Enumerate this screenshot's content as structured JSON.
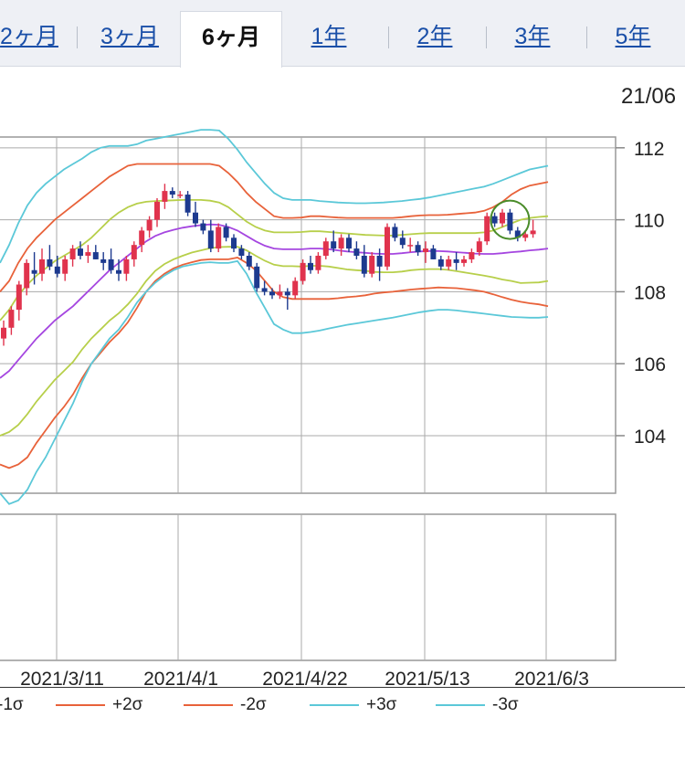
{
  "tabs": [
    {
      "label": "2ヶ月",
      "active": false
    },
    {
      "label": "3ヶ月",
      "active": false
    },
    {
      "label": "6ヶ月",
      "active": true
    },
    {
      "label": "1年",
      "active": false
    },
    {
      "label": "2年",
      "active": false
    },
    {
      "label": "3年",
      "active": false
    },
    {
      "label": "5年",
      "active": false
    }
  ],
  "date_label": "21/06",
  "legend": [
    {
      "label": "-1σ",
      "color": "#b7cf4a"
    },
    {
      "label": "+2σ",
      "color": "#e8623a"
    },
    {
      "label": "-2σ",
      "color": "#e8623a"
    },
    {
      "label": "+3σ",
      "color": "#5bc8d8"
    },
    {
      "label": "-3σ",
      "color": "#5bc8d8"
    }
  ],
  "chart_data": {
    "type": "line",
    "ylim": [
      102.4,
      112.3
    ],
    "y_ticks": [
      "112",
      "110",
      "108",
      "106",
      "104"
    ],
    "x_tick_labels": [
      "2021/3/11",
      "2021/4/1",
      "2021/4/22",
      "2021/5/13",
      "2021/6/3"
    ],
    "candle_up_color": "#e0334d",
    "candle_down_color": "#1d3a8f",
    "highlight_color": "#4a8c2a",
    "highlight_circle": {
      "x": 111.6,
      "y": 110.0
    },
    "x": [
      0,
      2,
      4,
      6,
      8,
      10,
      12,
      14,
      16,
      18,
      20,
      22,
      24,
      26,
      28,
      30,
      32,
      34,
      36,
      38,
      40,
      42,
      44,
      46,
      48,
      50,
      52,
      54,
      56,
      58,
      60,
      62,
      64,
      66,
      68,
      70,
      72,
      74,
      76,
      78,
      80,
      82,
      84,
      86,
      88,
      90,
      92,
      94,
      96,
      98,
      100,
      102,
      104,
      106,
      108,
      110,
      112,
      114,
      116,
      118,
      120
    ],
    "series": [
      {
        "id": "ma",
        "color": "#a546e0",
        "values": [
          105.6,
          105.8,
          106.1,
          106.4,
          106.7,
          106.95,
          107.2,
          107.4,
          107.6,
          107.85,
          108.1,
          108.35,
          108.6,
          108.8,
          109.0,
          109.2,
          109.4,
          109.55,
          109.65,
          109.72,
          109.78,
          109.82,
          109.85,
          109.87,
          109.86,
          109.8,
          109.7,
          109.55,
          109.4,
          109.28,
          109.2,
          109.18,
          109.18,
          109.18,
          109.2,
          109.2,
          109.18,
          109.15,
          109.12,
          109.1,
          109.08,
          109.06,
          109.05,
          109.05,
          109.07,
          109.1,
          109.12,
          109.13,
          109.13,
          109.12,
          109.1,
          109.08,
          109.06,
          109.05,
          109.05,
          109.07,
          109.1,
          109.12,
          109.15,
          109.17,
          109.2
        ]
      },
      {
        "id": "p1",
        "color": "#b7cf4a",
        "values": [
          107.2,
          107.5,
          107.9,
          108.2,
          108.45,
          108.65,
          108.85,
          109.0,
          109.15,
          109.3,
          109.5,
          109.75,
          110.0,
          110.2,
          110.35,
          110.45,
          110.5,
          110.52,
          110.53,
          110.54,
          110.55,
          110.55,
          110.55,
          110.53,
          110.48,
          110.35,
          110.15,
          109.95,
          109.8,
          109.7,
          109.65,
          109.65,
          109.65,
          109.66,
          109.68,
          109.68,
          109.66,
          109.64,
          109.62,
          109.6,
          109.58,
          109.57,
          109.56,
          109.56,
          109.58,
          109.6,
          109.62,
          109.63,
          109.63,
          109.63,
          109.63,
          109.63,
          109.63,
          109.65,
          109.7,
          109.8,
          109.9,
          110.0,
          110.05,
          110.08,
          110.1
        ]
      },
      {
        "id": "m1",
        "color": "#b7cf4a",
        "values": [
          104.0,
          104.1,
          104.3,
          104.6,
          104.95,
          105.25,
          105.55,
          105.8,
          106.05,
          106.4,
          106.7,
          106.95,
          107.2,
          107.4,
          107.65,
          107.95,
          108.3,
          108.58,
          108.77,
          108.9,
          109.0,
          109.09,
          109.15,
          109.21,
          109.24,
          109.25,
          109.25,
          109.15,
          109.0,
          108.86,
          108.75,
          108.71,
          108.71,
          108.7,
          108.72,
          108.72,
          108.7,
          108.66,
          108.62,
          108.6,
          108.58,
          108.55,
          108.54,
          108.54,
          108.56,
          108.6,
          108.62,
          108.63,
          108.63,
          108.61,
          108.57,
          108.53,
          108.49,
          108.45,
          108.4,
          108.34,
          108.3,
          108.24,
          108.25,
          108.26,
          108.3
        ]
      },
      {
        "id": "p2",
        "color": "#e8623a",
        "values": [
          108.0,
          108.3,
          108.8,
          109.2,
          109.5,
          109.75,
          110.0,
          110.2,
          110.4,
          110.6,
          110.8,
          111.0,
          111.2,
          111.35,
          111.5,
          111.55,
          111.55,
          111.55,
          111.55,
          111.55,
          111.55,
          111.55,
          111.55,
          111.55,
          111.5,
          111.3,
          111.05,
          110.75,
          110.5,
          110.3,
          110.1,
          110.05,
          110.05,
          110.06,
          110.1,
          110.1,
          110.08,
          110.06,
          110.05,
          110.05,
          110.05,
          110.05,
          110.05,
          110.05,
          110.07,
          110.1,
          110.12,
          110.13,
          110.13,
          110.14,
          110.16,
          110.18,
          110.2,
          110.25,
          110.35,
          110.5,
          110.7,
          110.85,
          110.95,
          111.0,
          111.05
        ]
      },
      {
        "id": "m2",
        "color": "#e8623a",
        "values": [
          103.2,
          103.1,
          103.2,
          103.4,
          103.8,
          104.15,
          104.5,
          104.8,
          105.15,
          105.6,
          106.0,
          106.3,
          106.6,
          106.85,
          107.15,
          107.55,
          108.0,
          108.3,
          108.5,
          108.65,
          108.75,
          108.82,
          108.88,
          108.9,
          108.9,
          108.9,
          108.95,
          108.8,
          108.6,
          108.3,
          108.0,
          107.85,
          107.8,
          107.8,
          107.8,
          107.8,
          107.8,
          107.82,
          107.85,
          107.87,
          107.9,
          107.95,
          107.98,
          108.0,
          108.03,
          108.06,
          108.08,
          108.1,
          108.12,
          108.11,
          108.1,
          108.07,
          108.04,
          108.0,
          107.93,
          107.85,
          107.78,
          107.72,
          107.68,
          107.65,
          107.6
        ]
      },
      {
        "id": "p3",
        "color": "#5bc8d8",
        "values": [
          108.8,
          109.3,
          109.9,
          110.4,
          110.75,
          111.0,
          111.2,
          111.4,
          111.55,
          111.7,
          111.88,
          112.0,
          112.05,
          112.05,
          112.05,
          112.1,
          112.2,
          112.25,
          112.3,
          112.35,
          112.4,
          112.45,
          112.5,
          112.5,
          112.48,
          112.25,
          111.95,
          111.6,
          111.3,
          111.0,
          110.75,
          110.6,
          110.55,
          110.55,
          110.55,
          110.52,
          110.5,
          110.48,
          110.47,
          110.46,
          110.46,
          110.47,
          110.48,
          110.5,
          110.52,
          110.55,
          110.58,
          110.62,
          110.67,
          110.72,
          110.77,
          110.82,
          110.87,
          110.92,
          111.0,
          111.1,
          111.2,
          111.3,
          111.4,
          111.45,
          111.5
        ]
      },
      {
        "id": "m3",
        "color": "#5bc8d8",
        "values": [
          102.4,
          102.1,
          102.2,
          102.5,
          103.0,
          103.4,
          103.9,
          104.4,
          104.9,
          105.5,
          106.0,
          106.35,
          106.7,
          106.95,
          107.3,
          107.7,
          108.0,
          108.25,
          108.45,
          108.6,
          108.7,
          108.75,
          108.8,
          108.82,
          108.8,
          108.8,
          108.85,
          108.5,
          108.0,
          107.55,
          107.1,
          106.95,
          106.85,
          106.85,
          106.88,
          106.92,
          106.98,
          107.03,
          107.08,
          107.12,
          107.16,
          107.2,
          107.24,
          107.28,
          107.33,
          107.38,
          107.43,
          107.47,
          107.5,
          107.5,
          107.48,
          107.45,
          107.42,
          107.39,
          107.36,
          107.33,
          107.3,
          107.29,
          107.28,
          107.28,
          107.3
        ]
      }
    ],
    "candles": [
      {
        "x": 0,
        "o": 106.7,
        "h": 107.2,
        "l": 106.5,
        "c": 107.0
      },
      {
        "x": 1,
        "o": 107.0,
        "h": 107.6,
        "l": 106.8,
        "c": 107.5
      },
      {
        "x": 2,
        "o": 107.5,
        "h": 108.3,
        "l": 107.2,
        "c": 108.2
      },
      {
        "x": 3,
        "o": 108.1,
        "h": 108.9,
        "l": 107.9,
        "c": 108.8
      },
      {
        "x": 4,
        "o": 108.6,
        "h": 109.1,
        "l": 108.2,
        "c": 108.5
      },
      {
        "x": 5,
        "o": 108.5,
        "h": 109.2,
        "l": 108.3,
        "c": 108.9
      },
      {
        "x": 6,
        "o": 108.9,
        "h": 109.3,
        "l": 108.6,
        "c": 108.7
      },
      {
        "x": 7,
        "o": 108.7,
        "h": 109.0,
        "l": 108.4,
        "c": 108.5
      },
      {
        "x": 8,
        "o": 108.5,
        "h": 109.0,
        "l": 108.3,
        "c": 108.9
      },
      {
        "x": 9,
        "o": 108.9,
        "h": 109.3,
        "l": 108.7,
        "c": 109.2
      },
      {
        "x": 10,
        "o": 109.2,
        "h": 109.4,
        "l": 108.9,
        "c": 109.0
      },
      {
        "x": 11,
        "o": 109.0,
        "h": 109.3,
        "l": 108.8,
        "c": 109.1
      },
      {
        "x": 12,
        "o": 109.1,
        "h": 109.3,
        "l": 108.9,
        "c": 108.9
      },
      {
        "x": 13,
        "o": 108.9,
        "h": 109.1,
        "l": 108.6,
        "c": 108.8
      },
      {
        "x": 14,
        "o": 108.9,
        "h": 109.2,
        "l": 108.5,
        "c": 108.6
      },
      {
        "x": 15,
        "o": 108.6,
        "h": 108.9,
        "l": 108.3,
        "c": 108.5
      },
      {
        "x": 16,
        "o": 108.5,
        "h": 109.0,
        "l": 108.3,
        "c": 108.9
      },
      {
        "x": 17,
        "o": 108.9,
        "h": 109.4,
        "l": 108.7,
        "c": 109.3
      },
      {
        "x": 18,
        "o": 109.3,
        "h": 109.8,
        "l": 109.1,
        "c": 109.7
      },
      {
        "x": 19,
        "o": 109.7,
        "h": 110.1,
        "l": 109.5,
        "c": 110.0
      },
      {
        "x": 20,
        "o": 110.0,
        "h": 110.6,
        "l": 109.8,
        "c": 110.5
      },
      {
        "x": 21,
        "o": 110.5,
        "h": 111.0,
        "l": 110.3,
        "c": 110.8
      },
      {
        "x": 22,
        "o": 110.8,
        "h": 110.9,
        "l": 110.6,
        "c": 110.7
      },
      {
        "x": 23,
        "o": 110.7,
        "h": 110.8,
        "l": 110.6,
        "c": 110.7
      },
      {
        "x": 24,
        "o": 110.7,
        "h": 110.8,
        "l": 110.1,
        "c": 110.2
      },
      {
        "x": 25,
        "o": 110.2,
        "h": 110.5,
        "l": 109.8,
        "c": 109.9
      },
      {
        "x": 26,
        "o": 109.9,
        "h": 110.0,
        "l": 109.6,
        "c": 109.7
      },
      {
        "x": 27,
        "o": 109.7,
        "h": 110.0,
        "l": 109.1,
        "c": 109.2
      },
      {
        "x": 28,
        "o": 109.2,
        "h": 109.9,
        "l": 109.1,
        "c": 109.8
      },
      {
        "x": 29,
        "o": 109.8,
        "h": 109.9,
        "l": 109.4,
        "c": 109.5
      },
      {
        "x": 30,
        "o": 109.5,
        "h": 109.6,
        "l": 109.1,
        "c": 109.2
      },
      {
        "x": 31,
        "o": 109.2,
        "h": 109.3,
        "l": 108.9,
        "c": 109.0
      },
      {
        "x": 32,
        "o": 109.0,
        "h": 109.1,
        "l": 108.6,
        "c": 108.7
      },
      {
        "x": 33,
        "o": 108.7,
        "h": 108.8,
        "l": 108.0,
        "c": 108.1
      },
      {
        "x": 34,
        "o": 108.1,
        "h": 108.3,
        "l": 107.9,
        "c": 108.0
      },
      {
        "x": 35,
        "o": 108.0,
        "h": 108.1,
        "l": 107.8,
        "c": 107.9
      },
      {
        "x": 36,
        "o": 107.9,
        "h": 108.2,
        "l": 107.8,
        "c": 108.0
      },
      {
        "x": 37,
        "o": 108.0,
        "h": 108.1,
        "l": 107.5,
        "c": 107.9
      },
      {
        "x": 38,
        "o": 107.9,
        "h": 108.4,
        "l": 107.8,
        "c": 108.3
      },
      {
        "x": 39,
        "o": 108.3,
        "h": 108.9,
        "l": 108.2,
        "c": 108.8
      },
      {
        "x": 40,
        "o": 108.8,
        "h": 109.0,
        "l": 108.5,
        "c": 108.6
      },
      {
        "x": 41,
        "o": 108.6,
        "h": 109.1,
        "l": 108.5,
        "c": 109.0
      },
      {
        "x": 42,
        "o": 109.0,
        "h": 109.5,
        "l": 108.9,
        "c": 109.4
      },
      {
        "x": 43,
        "o": 109.4,
        "h": 109.7,
        "l": 109.1,
        "c": 109.2
      },
      {
        "x": 44,
        "o": 109.2,
        "h": 109.6,
        "l": 109.0,
        "c": 109.5
      },
      {
        "x": 45,
        "o": 109.5,
        "h": 109.6,
        "l": 109.1,
        "c": 109.2
      },
      {
        "x": 46,
        "o": 109.2,
        "h": 109.4,
        "l": 108.9,
        "c": 109.0
      },
      {
        "x": 47,
        "o": 109.0,
        "h": 109.3,
        "l": 108.4,
        "c": 108.5
      },
      {
        "x": 48,
        "o": 108.5,
        "h": 109.1,
        "l": 108.4,
        "c": 109.0
      },
      {
        "x": 49,
        "o": 109.0,
        "h": 109.2,
        "l": 108.3,
        "c": 108.7
      },
      {
        "x": 50,
        "o": 108.7,
        "h": 109.9,
        "l": 108.6,
        "c": 109.8
      },
      {
        "x": 51,
        "o": 109.8,
        "h": 109.9,
        "l": 109.4,
        "c": 109.5
      },
      {
        "x": 52,
        "o": 109.5,
        "h": 109.7,
        "l": 109.2,
        "c": 109.3
      },
      {
        "x": 53,
        "o": 109.3,
        "h": 109.5,
        "l": 109.1,
        "c": 109.3
      },
      {
        "x": 54,
        "o": 109.3,
        "h": 109.4,
        "l": 109.0,
        "c": 109.1
      },
      {
        "x": 55,
        "o": 109.1,
        "h": 109.4,
        "l": 108.8,
        "c": 109.2
      },
      {
        "x": 56,
        "o": 109.2,
        "h": 109.3,
        "l": 108.9,
        "c": 108.9
      },
      {
        "x": 57,
        "o": 108.9,
        "h": 109.0,
        "l": 108.6,
        "c": 108.7
      },
      {
        "x": 58,
        "o": 108.7,
        "h": 109.0,
        "l": 108.6,
        "c": 108.9
      },
      {
        "x": 59,
        "o": 108.9,
        "h": 109.1,
        "l": 108.6,
        "c": 108.8
      },
      {
        "x": 60,
        "o": 108.8,
        "h": 109.0,
        "l": 108.7,
        "c": 108.9
      },
      {
        "x": 61,
        "o": 108.9,
        "h": 109.2,
        "l": 108.8,
        "c": 109.1
      },
      {
        "x": 62,
        "o": 109.1,
        "h": 109.5,
        "l": 109.0,
        "c": 109.4
      },
      {
        "x": 63,
        "o": 109.4,
        "h": 110.2,
        "l": 109.3,
        "c": 110.1
      },
      {
        "x": 64,
        "o": 110.1,
        "h": 110.2,
        "l": 109.8,
        "c": 109.9
      },
      {
        "x": 65,
        "o": 109.9,
        "h": 110.3,
        "l": 109.8,
        "c": 110.2
      },
      {
        "x": 66,
        "o": 110.2,
        "h": 110.3,
        "l": 109.6,
        "c": 109.7
      },
      {
        "x": 67,
        "o": 109.7,
        "h": 109.8,
        "l": 109.4,
        "c": 109.5
      },
      {
        "x": 68,
        "o": 109.5,
        "h": 109.7,
        "l": 109.4,
        "c": 109.6
      },
      {
        "x": 69,
        "o": 109.6,
        "h": 110.0,
        "l": 109.5,
        "c": 109.7
      }
    ]
  }
}
